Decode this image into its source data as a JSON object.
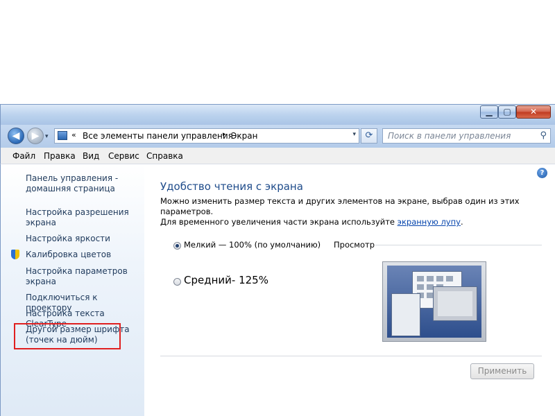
{
  "window": {
    "minimize_glyph": "▁",
    "maximize_glyph": "▢",
    "close_glyph": "✕"
  },
  "nav": {
    "back_icon": "back-arrow",
    "back_glyph": "◀",
    "forward_icon": "forward-arrow",
    "forward_glyph": "▶",
    "history_dropdown_glyph": "▾"
  },
  "address": {
    "chevron": "«",
    "crumbs": [
      "Все элементы панели управления",
      "Экран"
    ],
    "separator": "▸",
    "dropdown_glyph": "▾"
  },
  "refresh": {
    "icon": "refresh-icon",
    "glyph": "⟳"
  },
  "search": {
    "placeholder": "Поиск в панели управления",
    "icon": "magnifier",
    "glyph": "⚲"
  },
  "menu": [
    "Файл",
    "Правка",
    "Вид",
    "Сервис",
    "Справка"
  ],
  "sidebar": {
    "home_link": "Панель управления - домашняя страница",
    "links": [
      "Настройка разрешения экрана",
      "Настройка яркости",
      "Калибровка цветов",
      "Настройка параметров экрана",
      "Подключиться к проектору",
      "Настройка текста ClearType",
      "Другой размер шрифта (точек на дюйм)"
    ],
    "highlight_color": "#e01f1f"
  },
  "main": {
    "help_glyph": "?",
    "heading": "Удобство чтения с экрана",
    "description_line1": "Можно изменить размер текста и других элементов на экране, выбрав один из этих параметров.",
    "description_line2_prefix": "Для временного увеличения части экрана используйте ",
    "description_link": "экранную лупу",
    "description_suffix": ".",
    "options": [
      {
        "label": "Мелкий — 100% (по умолчанию)",
        "selected": true
      },
      {
        "label": "Средний- 125%",
        "selected": false
      }
    ],
    "preview_label": "Просмотр",
    "apply_button": "Применить"
  },
  "colors": {
    "heading": "#1e4b8a",
    "link": "#1e395b",
    "accent": "#0645ad"
  }
}
